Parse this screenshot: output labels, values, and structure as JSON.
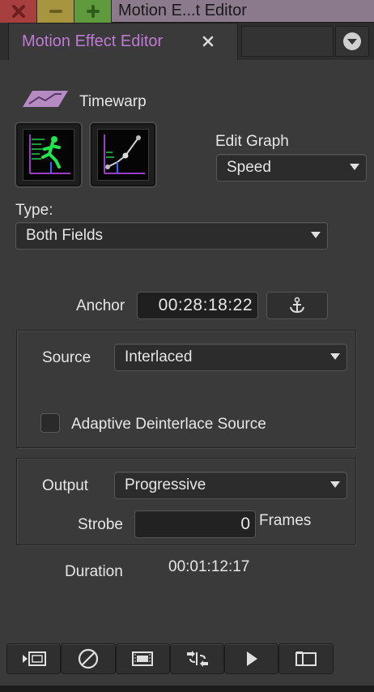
{
  "window": {
    "title": "Motion E...t Editor",
    "controls": {
      "close_icon": "close-icon",
      "minimize_icon": "minus-icon",
      "maximize_icon": "plus-icon"
    }
  },
  "tab": {
    "title": "Motion Effect Editor",
    "close_icon": "x-icon",
    "menu_icon": "chevron-down-circle-icon"
  },
  "effect": {
    "name": "Timewarp",
    "icon": "timewarp-icon"
  },
  "graph_buttons": [
    {
      "name": "speed-graph-icon"
    },
    {
      "name": "position-graph-icon"
    }
  ],
  "edit_graph": {
    "label": "Edit Graph",
    "value": "Speed"
  },
  "type": {
    "label": "Type:",
    "value": "Both Fields"
  },
  "anchor": {
    "label": "Anchor",
    "timecode": "00:28:18:22",
    "button_icon": "anchor-icon"
  },
  "source": {
    "label": "Source",
    "value": "Interlaced",
    "adaptive_label": "Adaptive Deinterlace Source",
    "adaptive_checked": false
  },
  "output": {
    "label": "Output",
    "value": "Progressive",
    "strobe_label": "Strobe",
    "strobe_value": "0",
    "strobe_unit": "Frames"
  },
  "duration": {
    "label": "Duration",
    "value": "00:01:12:17"
  },
  "toolbar": [
    {
      "name": "render-effect-icon"
    },
    {
      "name": "disable-icon"
    },
    {
      "name": "film-strip-icon"
    },
    {
      "name": "swap-icon"
    },
    {
      "name": "play-icon"
    },
    {
      "name": "panel-icon"
    }
  ],
  "colors": {
    "accent": "#c07ad6",
    "background": "#3a3a3a",
    "title_bar": "#8a7a8c",
    "close": "#a73f3f",
    "minimize": "#a79540",
    "maximize": "#5f9a3f"
  }
}
